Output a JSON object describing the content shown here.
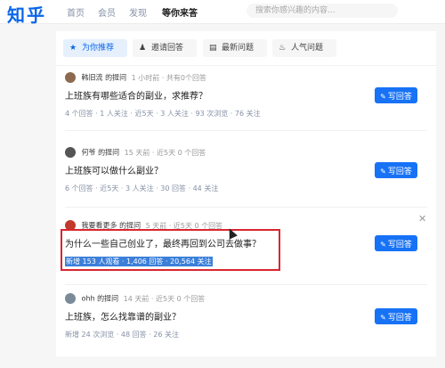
{
  "header": {
    "logo": "知乎",
    "nav": [
      "首页",
      "会员",
      "发现",
      "等你来答"
    ],
    "active_nav": "等你来答",
    "search_placeholder": "搜索你感兴趣的内容..."
  },
  "tabs": [
    {
      "label": "为你推荐",
      "icon": "star-icon",
      "active": true
    },
    {
      "label": "邀请回答",
      "icon": "invite-icon",
      "active": false
    },
    {
      "label": "最新问题",
      "icon": "latest-icon",
      "active": false
    },
    {
      "label": "人气问题",
      "icon": "flame-icon",
      "active": false
    }
  ],
  "answer_label": "写回答",
  "questions": [
    {
      "user": "韩旧流 的提问",
      "time": "1 小时前 · 共有0个回答",
      "title": "上班族有哪些适合的副业，求推荐？",
      "stats": "4 个回答 · 1 人关注 · 近5天 · 3 人关注 · 93 次浏览 · 76 关注",
      "avatar_color": "#8b6a4f"
    },
    {
      "user": "何爷 的提问",
      "time": "15 天前 · 近5天 0 个回答",
      "title": "上班族可以做什么副业？",
      "stats": "6 个回答 · 近5天 · 3 人关注 · 30 回答 · 44 关注",
      "avatar_color": "#555555"
    },
    {
      "user": "我要看更多 的提问",
      "time": "5 天前 · 近5天 0 个回答",
      "title": "为什么一些自己创业了，最终再回到公司去做事？",
      "stats": "新增 153 人观看 · 1,406 回答 · 20,564 关注",
      "avatar_color": "#c0392b",
      "selected": true
    },
    {
      "user": "ohh 的提问",
      "time": "14 天前 · 近5天 0 个回答",
      "title": "上班族，怎么找靠谱的副业？",
      "stats": "新增 24 次浏览 · 48 回答 · 26 关注",
      "avatar_color": "#7a8a99"
    }
  ],
  "colors": {
    "brand": "#0a66e8",
    "button": "#1772f6",
    "highlight_border": "#d9262f"
  },
  "close_icon": "✕"
}
